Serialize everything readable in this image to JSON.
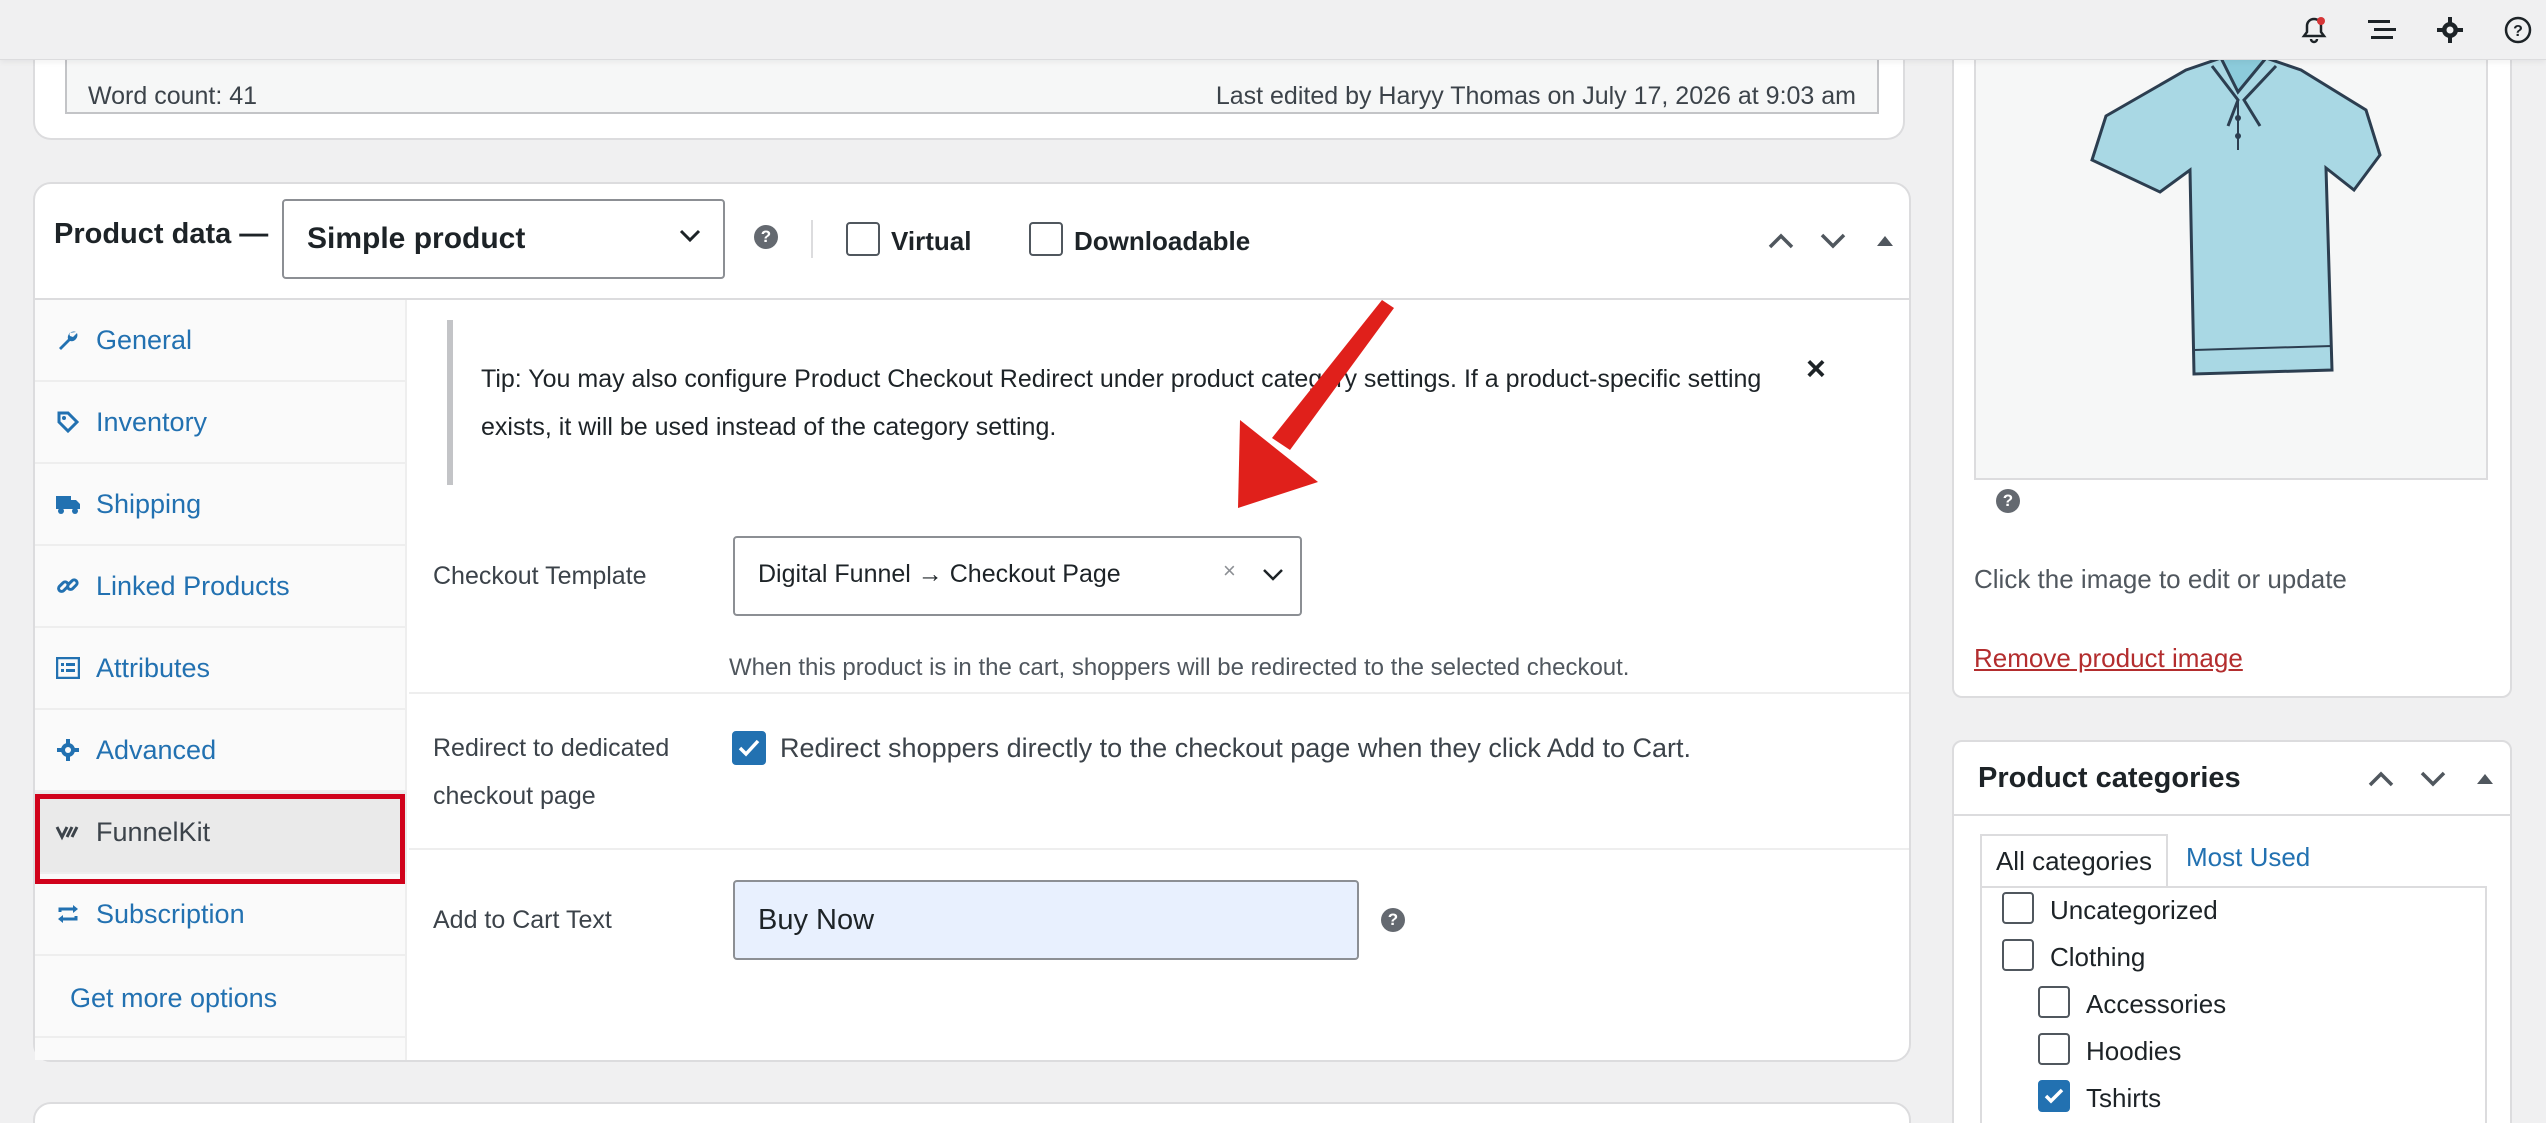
{
  "editor": {
    "word_count": "Word count: 41",
    "last_edited": "Last edited by Haryy Thomas on July 17, 2026 at 9:03 am"
  },
  "product_data": {
    "title": "Product data —",
    "type_select": "Simple product",
    "help": "?",
    "virtual_label": "Virtual",
    "downloadable_label": "Downloadable"
  },
  "tabs": [
    {
      "label": "General",
      "icon": "wrench-icon"
    },
    {
      "label": "Inventory",
      "icon": "tag-icon"
    },
    {
      "label": "Shipping",
      "icon": "truck-icon"
    },
    {
      "label": "Linked Products",
      "icon": "link-icon"
    },
    {
      "label": "Attributes",
      "icon": "list-icon"
    },
    {
      "label": "Advanced",
      "icon": "gear-icon"
    },
    {
      "label": "FunnelKit",
      "icon": "funnelkit-icon"
    },
    {
      "label": "Subscription",
      "icon": "repeat-icon"
    }
  ],
  "more_options": "Get more options",
  "tip": {
    "text": "Tip: You may also configure Product Checkout Redirect under product category settings. If a product-specific setting exists, it will be used instead of the category setting.",
    "close": "×"
  },
  "checkout_template": {
    "label": "Checkout Template",
    "value": "Digital Funnel → Checkout Page",
    "clear": "×",
    "description": "When this product is in the cart, shoppers will be redirected to the selected checkout."
  },
  "redirect": {
    "label_line1": "Redirect to dedicated",
    "label_line2": "checkout page",
    "checked": true,
    "description": "Redirect shoppers directly to the checkout page when they click Add to Cart."
  },
  "add_to_cart": {
    "label": "Add to Cart Text",
    "value": "Buy Now",
    "help": "?"
  },
  "product_image": {
    "help": "?",
    "caption": "Click the image to edit or update",
    "remove": "Remove product image"
  },
  "categories": {
    "title": "Product categories",
    "tab_all": "All categories",
    "tab_most_used": "Most Used",
    "items": [
      {
        "label": "Uncategorized",
        "checked": false,
        "child": false
      },
      {
        "label": "Clothing",
        "checked": false,
        "child": false
      },
      {
        "label": "Accessories",
        "checked": false,
        "child": true
      },
      {
        "label": "Hoodies",
        "checked": false,
        "child": true
      },
      {
        "label": "Tshirts",
        "checked": true,
        "child": true
      }
    ]
  },
  "colors": {
    "link": "#2271b1",
    "highlight": "#d0021b",
    "danger": "#b32d2e",
    "checkbox_checked": "#2271b1"
  }
}
